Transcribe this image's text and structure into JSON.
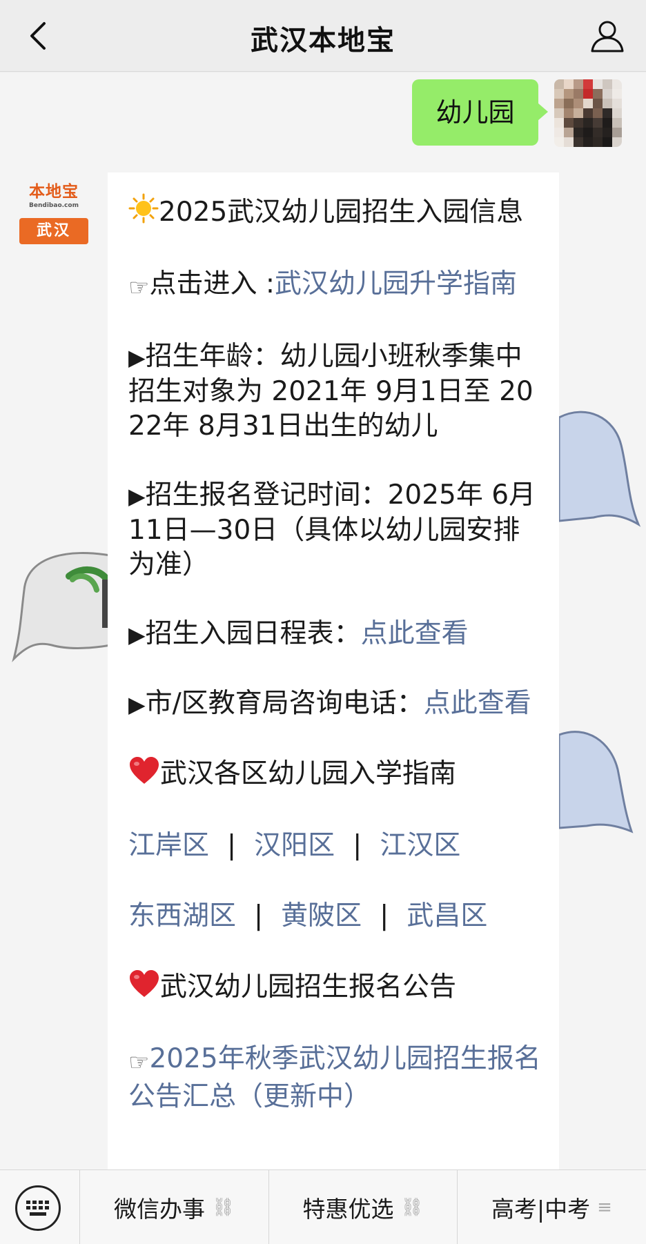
{
  "header": {
    "title": "武汉本地宝"
  },
  "outgoing": {
    "text": "幼儿园"
  },
  "bot": {
    "logo_cn": "本地宝",
    "logo_en": "Bendibao.com",
    "logo_city": "武汉"
  },
  "message": {
    "p1_text": "2025武汉幼儿园招生入园信息",
    "p2_prefix": "点击进入 :",
    "p2_link": "武汉幼儿园升学指南",
    "p3_text": "招生年龄：幼儿园小班秋季集中招生对象为 2021年 9月1日至 2022年 8月31日出生的幼儿",
    "p4_text": "招生报名登记时间：2025年 6月11日—30日（具体以幼儿园安排为准）",
    "p5_text": "招生入园日程表：",
    "p5_link": "点此查看",
    "p6_text": "市/区教育局咨询电话：",
    "p6_link": "点此查看",
    "p7_text": "武汉各区幼儿园入学指南",
    "districts_row1": [
      "江岸区",
      "汉阳区",
      "江汉区"
    ],
    "districts_row2": [
      "东西湖区",
      "黄陂区",
      "武昌区"
    ],
    "separator": "|",
    "p8_text": "武汉幼儿园招生报名公告",
    "p9_link": "2025年秋季武汉幼儿园招生报名公告汇总（更新中）"
  },
  "menu": {
    "item1": "微信办事",
    "item2": "特惠优选",
    "item3": "高考|中考"
  },
  "colors": {
    "link": "#586f98",
    "outgoing_bubble": "#95ec69",
    "logo_orange": "#ea6a24"
  }
}
